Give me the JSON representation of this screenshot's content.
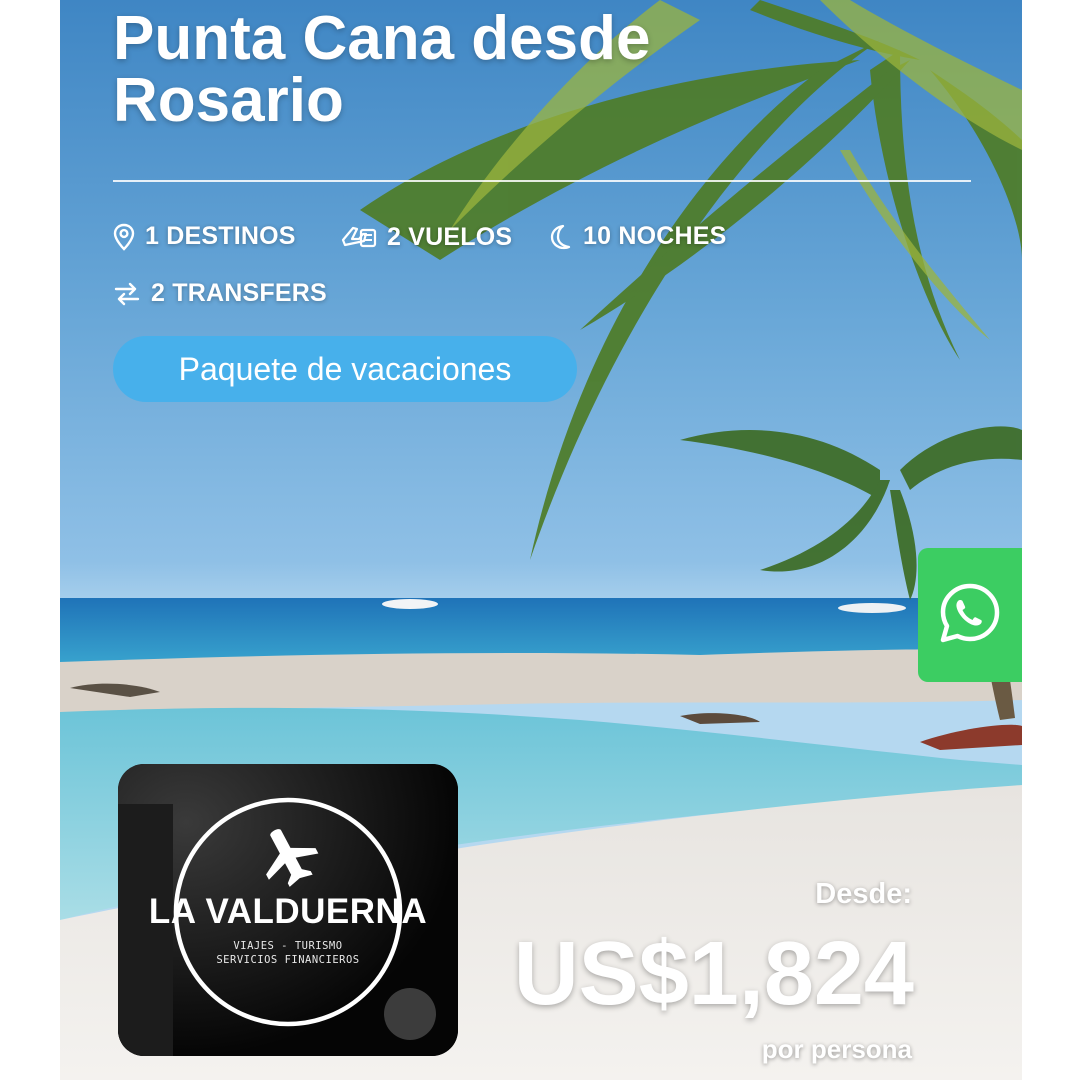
{
  "package": {
    "title": "Punta Cana desde\nRosario",
    "features": {
      "destinos": "1 DESTINOS",
      "vuelos": "2 VUELOS",
      "noches": "10 NOCHES",
      "transfers": "2 TRANSFERS"
    },
    "badge_label": "Paquete de vacaciones"
  },
  "pricing": {
    "prefix": "Desde:",
    "amount": "US$1,824",
    "suffix": "por persona"
  },
  "agency_logo": {
    "name": "LA VALDUERNA",
    "tagline_1": "VIAJES - TURISMO",
    "tagline_2": "SERVICIOS FINANCIEROS"
  },
  "icons": {
    "location": "map-pin-icon",
    "flights": "plane-seat-icon",
    "nights": "moon-icon",
    "transfers": "swap-arrows-icon",
    "whatsapp": "whatsapp-icon",
    "logo": "airplane-icon"
  },
  "colors": {
    "badge": "#47b0eb",
    "whatsapp": "#3ccd62",
    "text": "#ffffff"
  }
}
